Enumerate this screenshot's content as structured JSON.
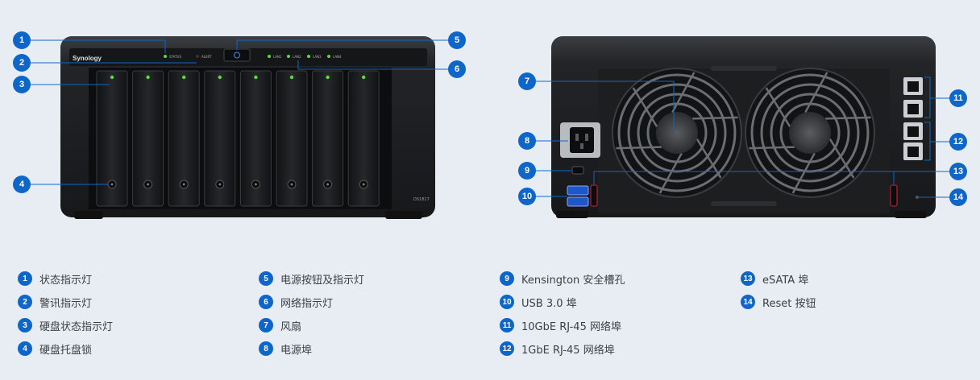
{
  "device": {
    "brand": "Synology",
    "model": "DS1817",
    "front_indicators": [
      "STATUS",
      "ALERT"
    ],
    "lan_indicators": [
      "LAN1",
      "LAN2",
      "LAN3",
      "LAN4"
    ]
  },
  "colors": {
    "accent": "#0f66c9",
    "background": "#e8edf4",
    "led": "#5cdc3a",
    "esata": "#d0243a"
  },
  "callouts": [
    "1",
    "2",
    "3",
    "4",
    "5",
    "6",
    "7",
    "8",
    "9",
    "10",
    "11",
    "12",
    "13",
    "14"
  ],
  "legend": [
    {
      "num": "1",
      "label": "状态指示灯"
    },
    {
      "num": "2",
      "label": "警讯指示灯"
    },
    {
      "num": "3",
      "label": "硬盘状态指示灯"
    },
    {
      "num": "4",
      "label": "硬盘托盘锁"
    },
    {
      "num": "5",
      "label": "电源按钮及指示灯"
    },
    {
      "num": "6",
      "label": "网络指示灯"
    },
    {
      "num": "7",
      "label": "风扇"
    },
    {
      "num": "8",
      "label": "电源埠"
    },
    {
      "num": "9",
      "label": "Kensington 安全槽孔"
    },
    {
      "num": "10",
      "label": "USB 3.0 埠"
    },
    {
      "num": "11",
      "label": "10GbE RJ-45 网络埠"
    },
    {
      "num": "12",
      "label": "1GbE RJ-45 网络埠"
    },
    {
      "num": "13",
      "label": "eSATA 埠"
    },
    {
      "num": "14",
      "label": "Reset 按钮"
    }
  ]
}
